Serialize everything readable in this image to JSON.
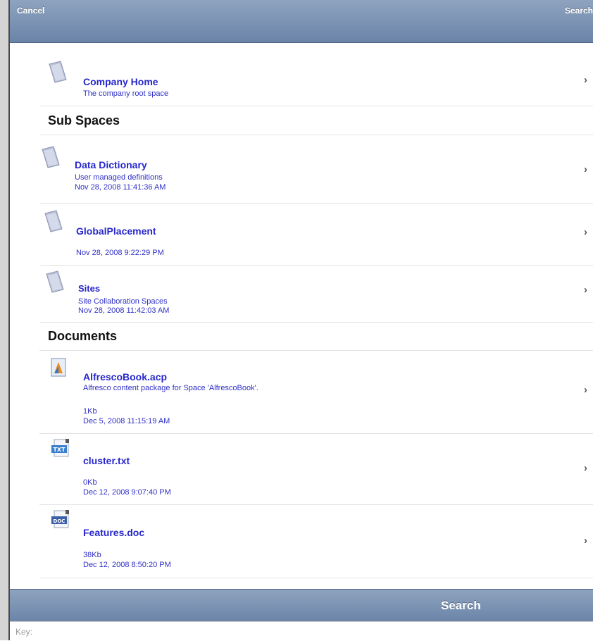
{
  "nav": {
    "cancel_label": "Cancel",
    "search_label": "Search"
  },
  "colors": {
    "bar": "#7b92b4",
    "link": "#2727cc"
  },
  "current_space": {
    "title": "Company Home",
    "description": "The company root space",
    "icon": "space-folder-icon"
  },
  "sub_spaces": {
    "header": "Sub Spaces",
    "items": [
      {
        "title": "Data Dictionary",
        "description": "User managed definitions",
        "date": "Nov 28, 2008 11:41:36 AM",
        "icon": "space-folder-icon"
      },
      {
        "title": "GlobalPlacement",
        "description": "",
        "date": "Nov 28, 2008 9:22:29 PM",
        "icon": "space-folder-icon"
      },
      {
        "title": "Sites",
        "description": "Site Collaboration Spaces",
        "date": "Nov 28, 2008 11:42:03 AM",
        "icon": "space-folder-icon"
      }
    ]
  },
  "documents": {
    "header": "Documents",
    "items": [
      {
        "title": "AlfrescoBook.acp",
        "description": "Alfresco content package for Space 'AlfrescoBook'.",
        "size": "1Kb",
        "date": "Dec 5, 2008 11:15:19 AM",
        "icon": "acp-package-icon"
      },
      {
        "title": "cluster.txt",
        "description": "",
        "size": "0Kb",
        "date": "Dec 12, 2008 9:07:40 PM",
        "icon": "txt-file-icon",
        "icon_text": "TXT"
      },
      {
        "title": "Features.doc",
        "description": "",
        "size": "38Kb",
        "date": "Dec 12, 2008 8:50:20 PM",
        "icon": "doc-file-icon",
        "icon_text": "DOC"
      }
    ]
  },
  "search_bar": {
    "title": "Search",
    "key_label": "Key:",
    "key_value": ""
  },
  "chevron": "›"
}
